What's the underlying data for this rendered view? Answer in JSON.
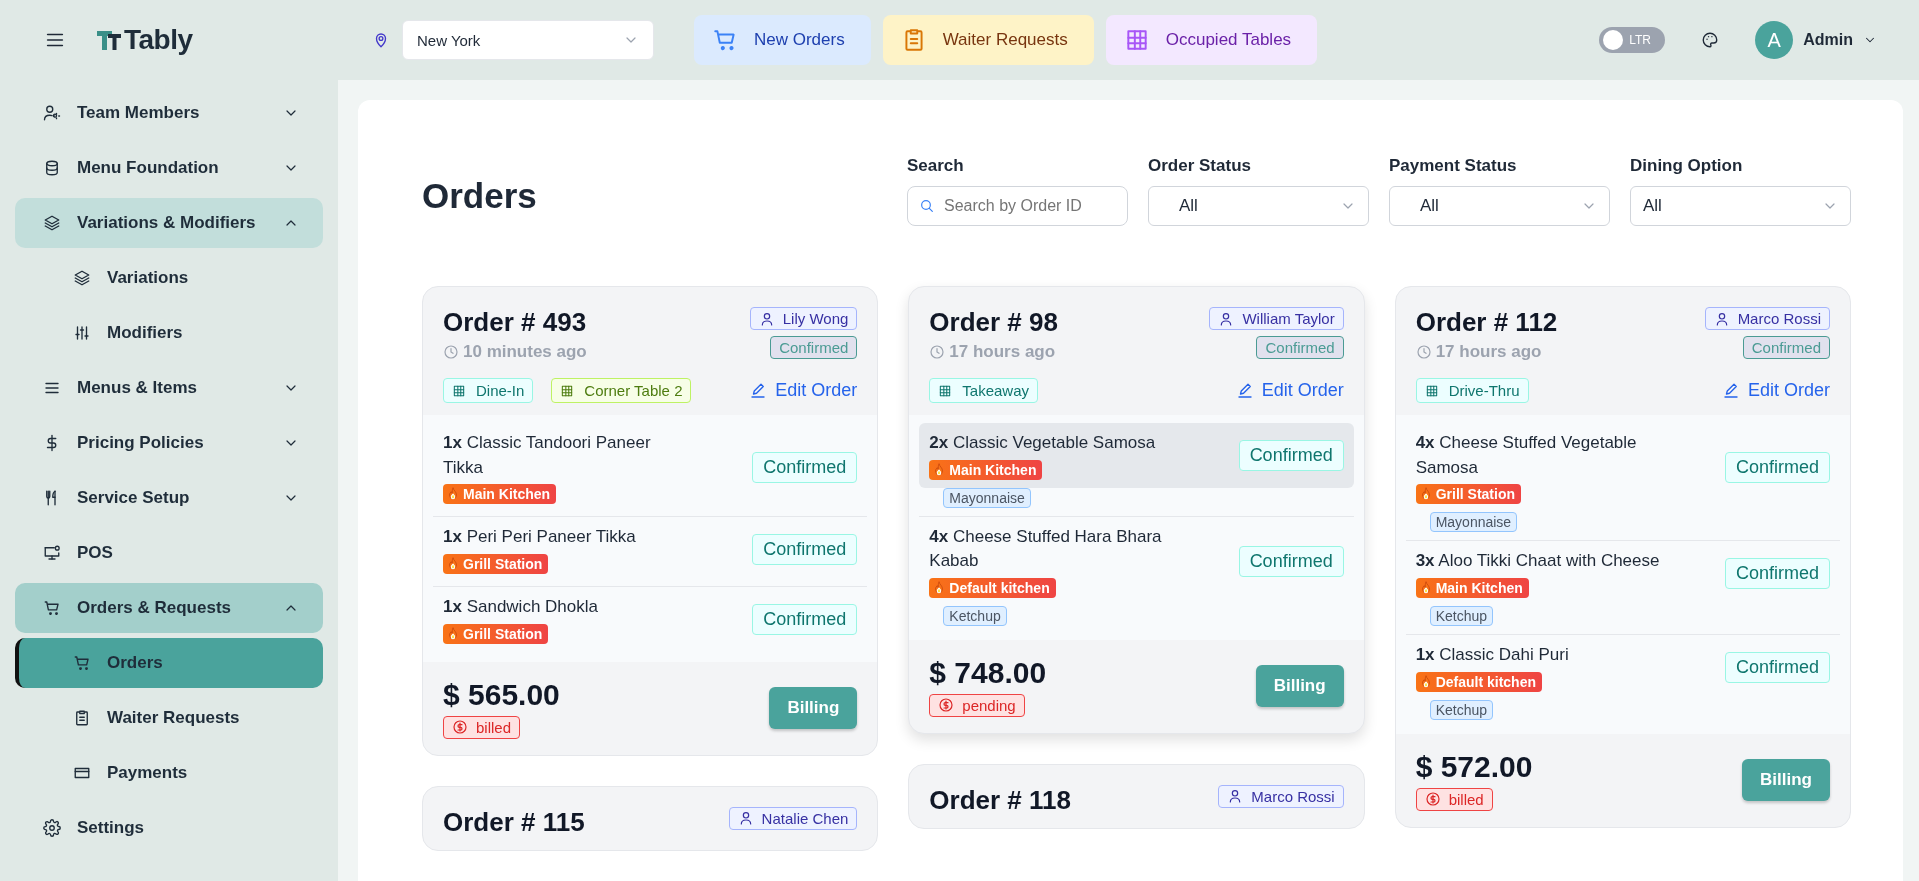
{
  "header": {
    "brand": "Tably",
    "location": "New York",
    "quick_actions": [
      {
        "label": "New Orders",
        "kind": "orders"
      },
      {
        "label": "Waiter Requests",
        "kind": "requests"
      },
      {
        "label": "Occupied Tables",
        "kind": "tables"
      }
    ],
    "direction_toggle": {
      "label": "LTR",
      "on": false
    },
    "user": {
      "initial": "A",
      "name": "Admin"
    }
  },
  "sidebar": {
    "items": [
      {
        "label": "Team Members",
        "expanded": false,
        "selected": false
      },
      {
        "label": "Menu Foundation",
        "expanded": false,
        "selected": false
      },
      {
        "label": "Variations & Modifiers",
        "expanded": true,
        "selected": false,
        "children": [
          {
            "label": "Variations",
            "selected": false
          },
          {
            "label": "Modifiers",
            "selected": false
          }
        ]
      },
      {
        "label": "Menus & Items",
        "expanded": false,
        "selected": false
      },
      {
        "label": "Pricing Policies",
        "expanded": false,
        "selected": false
      },
      {
        "label": "Service Setup",
        "expanded": false,
        "selected": false
      },
      {
        "label": "POS",
        "selected": false
      },
      {
        "label": "Orders & Requests",
        "expanded": true,
        "selected": false,
        "children": [
          {
            "label": "Orders",
            "selected": true
          },
          {
            "label": "Waiter Requests",
            "selected": false
          },
          {
            "label": "Payments",
            "selected": false
          }
        ]
      },
      {
        "label": "Settings",
        "selected": false
      }
    ]
  },
  "page": {
    "title": "Orders",
    "search": {
      "label": "Search",
      "placeholder": "Search by Order ID"
    },
    "filters": [
      {
        "label": "Order Status",
        "value": "All"
      },
      {
        "label": "Payment Status",
        "value": "All"
      },
      {
        "label": "Dining Option",
        "value": "All"
      }
    ],
    "columns": [
      [
        {
          "number": "Order # 493",
          "waiter": "Lily Wong",
          "time": "10 minutes ago",
          "status": "Confirmed",
          "tags": [
            {
              "label": "Dine-In",
              "kind": "dining"
            },
            {
              "label": "Corner Table 2",
              "kind": "table"
            }
          ],
          "edit": "Edit Order",
          "items": [
            {
              "qty": "1x",
              "name": "Classic Tandoori Paneer Tikka",
              "station": "Main Kitchen",
              "status": "Confirmed",
              "hovered": false
            },
            {
              "qty": "1x",
              "name": "Peri Peri Paneer Tikka",
              "station": "Grill Station",
              "status": "Confirmed",
              "hovered": false
            },
            {
              "qty": "1x",
              "name": "Sandwich Dhokla",
              "station": "Grill Station",
              "status": "Confirmed",
              "hovered": false
            }
          ],
          "total": "$ 565.00",
          "payment": "billed",
          "billing": "Billing"
        },
        {
          "number": "Order # 115",
          "waiter": "Natalie Chen"
        }
      ],
      [
        {
          "number": "Order # 98",
          "waiter": "William Taylor",
          "time": "17 hours ago",
          "status": "Confirmed",
          "tags": [
            {
              "label": "Takeaway",
              "kind": "dining"
            }
          ],
          "edit": "Edit Order",
          "items": [
            {
              "qty": "2x",
              "name": "Classic Vegetable Samosa",
              "station": "Main Kitchen",
              "status": "Confirmed",
              "modifiers": [
                "Mayonnaise"
              ],
              "hovered": true
            },
            {
              "qty": "4x",
              "name": "Cheese Stuffed Hara Bhara Kabab",
              "station": "Default kitchen",
              "status": "Confirmed",
              "modifiers": [
                "Ketchup"
              ],
              "hovered": false
            }
          ],
          "total": "$ 748.00",
          "payment": "pending",
          "billing": "Billing"
        },
        {
          "number": "Order # 118",
          "waiter": "Marco Rossi"
        }
      ],
      [
        {
          "number": "Order # 112",
          "waiter": "Marco Rossi",
          "time": "17 hours ago",
          "status": "Confirmed",
          "tags": [
            {
              "label": "Drive-Thru",
              "kind": "dining"
            }
          ],
          "edit": "Edit Order",
          "items": [
            {
              "qty": "4x",
              "name": "Cheese Stuffed Vegetable Samosa",
              "station": "Grill Station",
              "status": "Confirmed",
              "modifiers": [
                "Mayonnaise"
              ],
              "hovered": false
            },
            {
              "qty": "3x",
              "name": "Aloo Tikki Chaat with Cheese",
              "station": "Main Kitchen",
              "status": "Confirmed",
              "modifiers": [
                "Ketchup"
              ],
              "hovered": false
            },
            {
              "qty": "1x",
              "name": "Classic Dahi Puri",
              "station": "Default kitchen",
              "status": "Confirmed",
              "modifiers": [
                "Ketchup"
              ],
              "hovered": false
            }
          ],
          "total": "$ 572.00",
          "payment": "billed",
          "billing": "Billing"
        }
      ]
    ]
  }
}
